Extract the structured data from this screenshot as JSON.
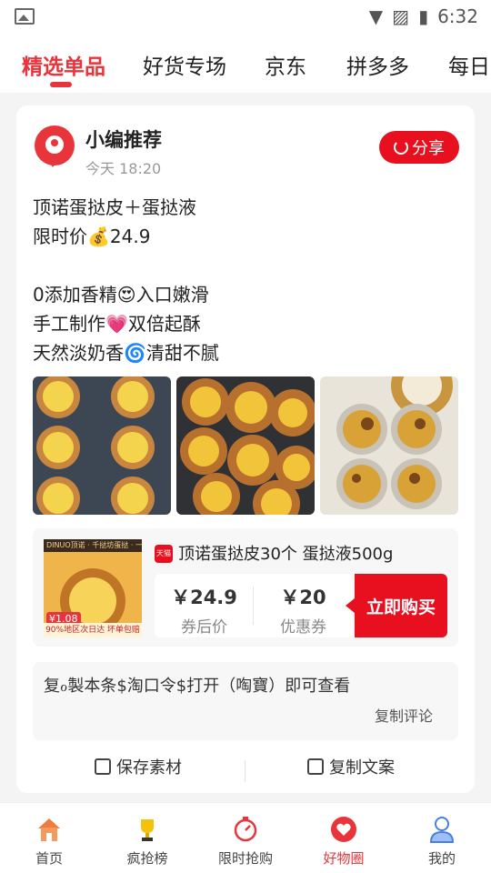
{
  "status_bar": {
    "time": "6:32"
  },
  "tabs": [
    {
      "label": "精选单品"
    },
    {
      "label": "好货专场"
    },
    {
      "label": "京东"
    },
    {
      "label": "拼多多"
    },
    {
      "label": "每日爆"
    }
  ],
  "post": {
    "author": "小编推荐",
    "time": "今天 18:20",
    "share_label": "分享",
    "text": "顶诺蛋挞皮＋蛋挞液\n限时价💰24.9\n\n0添加香精😍入口嫩滑\n手工制作💗双倍起酥\n天然淡奶香🌀清甜不腻"
  },
  "product": {
    "image_top_text": "DINUO顶诺 · 千挞坊蛋挞 · 一刻钟到手",
    "image_price": "¥1.08",
    "image_bottom_text": "90%地区次日达 坏单包赔",
    "store_badge": "天猫",
    "title": "顶诺蛋挞皮30个 蛋挞液500g",
    "price_after_coupon": "￥24.9",
    "price_after_coupon_label": "券后价",
    "coupon_value": "￥20",
    "coupon_label": "优惠券",
    "buy_label": "立即购买"
  },
  "comment": {
    "text": "复ℴ製本条$淘口令$打开（啕寶）即可查看",
    "copy_label": "复制评论"
  },
  "actions": {
    "save_material": "保存素材",
    "copy_text": "复制文案"
  },
  "bottom_nav": [
    {
      "label": "首页",
      "icon": "home-icon"
    },
    {
      "label": "疯抢榜",
      "icon": "trophy-icon"
    },
    {
      "label": "限时抢购",
      "icon": "timer-icon"
    },
    {
      "label": "好物圈",
      "icon": "heart-circle-icon",
      "active": true
    },
    {
      "label": "我的",
      "icon": "person-icon"
    }
  ],
  "colors": {
    "accent": "#e8343b",
    "buy_red": "#e8101f",
    "nav_blue": "#4a7fe0"
  }
}
